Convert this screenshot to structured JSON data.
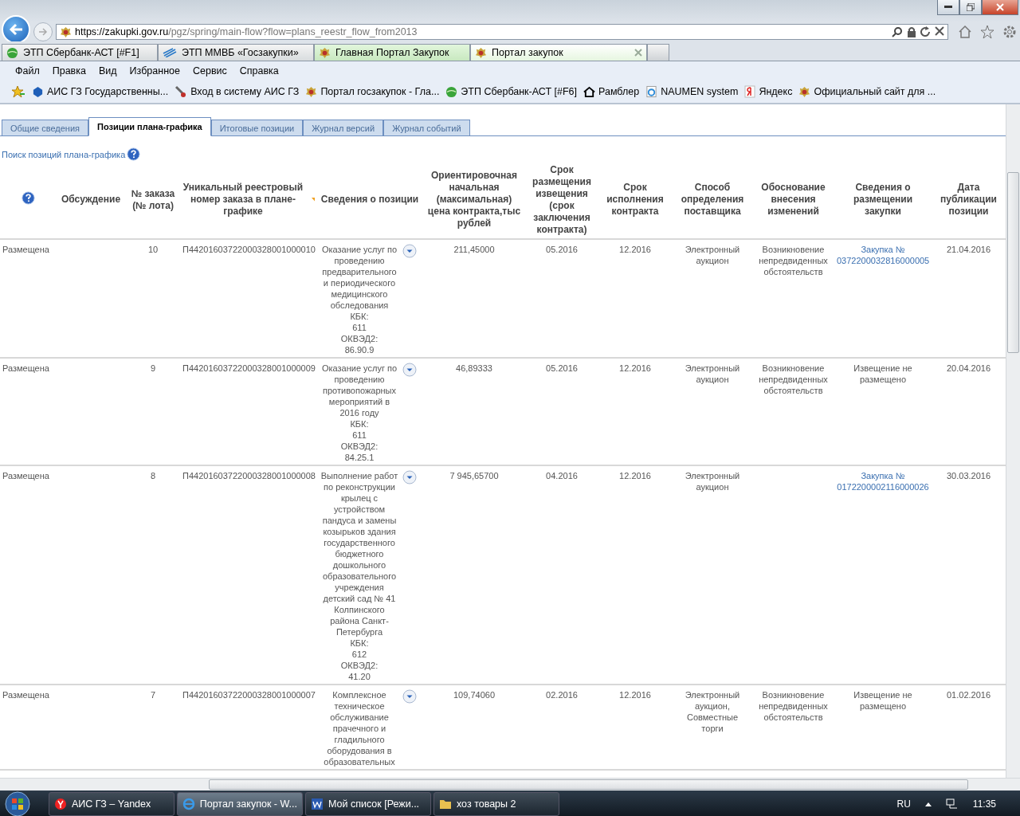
{
  "browser": {
    "address": {
      "host": "https://zakupki.gov.ru",
      "path": "/pgz/spring/main-flow?flow=plans_reestr_flow_from2013"
    },
    "tabs": [
      {
        "label": "ЭТП Сбербанк-АСТ [#F1]",
        "selected": false
      },
      {
        "label": "ЭТП ММВБ «Госзакупки»",
        "selected": false
      },
      {
        "label": "Главная Портал Закупок",
        "selected": false
      },
      {
        "label": "Портал закупок",
        "selected": true
      }
    ],
    "menu": [
      "Файл",
      "Правка",
      "Вид",
      "Избранное",
      "Сервис",
      "Справка"
    ],
    "favorites": [
      "АИС ГЗ  Государственны...",
      "Вход в систему  АИС ГЗ",
      "Портал госзакупок - Гла...",
      "ЭТП Сбербанк-АСТ [#F6]",
      "Рамблер",
      "NAUMEN system",
      "Яндекс",
      "Официальный сайт для ..."
    ]
  },
  "page": {
    "tabs": [
      {
        "label": "Общие сведения",
        "selected": false
      },
      {
        "label": "Позиции плана-графика",
        "selected": true
      },
      {
        "label": "Итоговые позиции",
        "selected": false
      },
      {
        "label": "Журнал версий",
        "selected": false
      },
      {
        "label": "Журнал событий",
        "selected": false
      }
    ],
    "search_link": "Поиск позиций плана-графика",
    "table": {
      "columns": [
        {
          "label": "Обсуждение",
          "sorted": false
        },
        {
          "label": "№ заказа (№ лота)",
          "sorted": false
        },
        {
          "label": "Уникальный реестровый номер заказа в плане-графике",
          "sorted": true
        },
        {
          "label": "Сведения о позиции",
          "sorted": false
        },
        {
          "label": "Ориентировочная начальная (максимальная) цена контракта,тыс рублей",
          "sorted": false
        },
        {
          "label": "Срок размещения извещения (срок заключения контракта)",
          "sorted": false
        },
        {
          "label": "Срок исполнения контракта",
          "sorted": false
        },
        {
          "label": "Способ определения поставщика",
          "sorted": false
        },
        {
          "label": "Обоснование внесения изменений",
          "sorted": false
        },
        {
          "label": "Сведения о размещении закупки",
          "sorted": false
        },
        {
          "label": "Дата публикации позиции",
          "sorted": false
        }
      ],
      "rows": [
        {
          "status": "Размещена",
          "order_no": "10",
          "reg_number": "П44201603722000328001000010",
          "description": [
            "Оказание услуг по проведению предварительного и периодического медицинского обследования",
            "КБК:",
            "611",
            "ОКВЭД2:",
            "86.90.9"
          ],
          "price": "211,45000",
          "placement_term": "05.2016",
          "execution_term": "12.2016",
          "method": "Электронный аукцион",
          "change_reason": "Возникновение непредвиденных обстоятельств",
          "procurement": {
            "text": "Закупка № 0372200032816000005",
            "link": true
          },
          "published": "21.04.2016"
        },
        {
          "status": "Размещена",
          "order_no": "9",
          "reg_number": "П44201603722000328001000009",
          "description": [
            "Оказание услуг по проведению противопожарных мероприятий в 2016 году",
            "КБК:",
            "611",
            "ОКВЭД2:",
            "84.25.1"
          ],
          "price": "46,89333",
          "placement_term": "05.2016",
          "execution_term": "12.2016",
          "method": "Электронный аукцион",
          "change_reason": "Возникновение непредвиденных обстоятельств",
          "procurement": {
            "text": "Извещение не размещено",
            "link": false
          },
          "published": "20.04.2016"
        },
        {
          "status": "Размещена",
          "order_no": "8",
          "reg_number": "П44201603722000328001000008",
          "description": [
            "Выполнение работ по реконструкции крылец с устройством пандуса и замены козырьков здания государственного бюджетного дошкольного образовательного учреждения детский сад № 41 Колпинского района Санкт-Петербурга",
            "КБК:",
            "612",
            "ОКВЭД2:",
            "41.20"
          ],
          "price": "7 945,65700",
          "placement_term": "04.2016",
          "execution_term": "12.2016",
          "method": "Электронный аукцион",
          "procurement": {
            "text": "Закупка № 0172200002116000026",
            "link": true
          },
          "published": "30.03.2016"
        },
        {
          "status": "Размещена",
          "order_no": "7",
          "reg_number": "П44201603722000328001000007",
          "description": [
            "Комплексное техническое обслуживание прачечного и гладильного оборудования в образовательных"
          ],
          "price": "109,74060",
          "placement_term": "02.2016",
          "execution_term": "12.2016",
          "method": "Электронный аукцион, Совместные торги",
          "change_reason": "Возникновение непредвиденных обстоятельств",
          "procurement": {
            "text": "Извещение не размещено",
            "link": false
          },
          "published": "01.02.2016"
        }
      ]
    }
  },
  "taskbar": {
    "items": [
      {
        "label": "АИС ГЗ – Yandex",
        "selected": false
      },
      {
        "label": "Портал закупок - W...",
        "selected": true
      },
      {
        "label": "Мой список [Режи...",
        "selected": false
      },
      {
        "label": "хоз товары 2",
        "selected": false
      }
    ],
    "language": "RU",
    "time": "11:35"
  }
}
